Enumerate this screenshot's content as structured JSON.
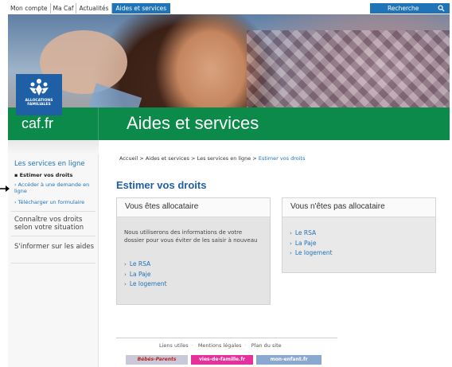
{
  "topnav": {
    "items": [
      "Mon compte",
      "Ma Caf",
      "Actualités",
      "Aides et services"
    ],
    "active_index": 3,
    "search_label": "Recherche"
  },
  "header": {
    "logo_text_line1": "ALLOCATIONS",
    "logo_text_line2": "FAMILIALES",
    "site_name": "caf.fr",
    "section_title": "Aides et services"
  },
  "sidebar": {
    "section_title": "Les services en ligne",
    "subitems": [
      {
        "label": "Estimer vos droits",
        "active": true
      },
      {
        "label": "Accéder à une demande en ligne",
        "active": false
      },
      {
        "label": "Télécharger un formulaire",
        "active": false
      }
    ],
    "other_items": [
      "Connaître vos droits selon votre situation",
      "S'informer sur les aides"
    ]
  },
  "breadcrumb": {
    "items": [
      "Accueil",
      "Aides et services",
      "Les services en ligne"
    ],
    "current": "Estimer vos droits",
    "separator": ">"
  },
  "main": {
    "title": "Estimer vos droits",
    "box_allocataire": {
      "heading": "Vous êtes allocataire",
      "text": "Nous utiliserons des informations de votre dossier pour vous éviter de les saisir à nouveau",
      "links": [
        "Le RSA",
        "La Paje",
        "Le logement"
      ]
    },
    "box_non_allocataire": {
      "heading": "Vous n'êtes pas allocataire",
      "links": [
        "Le RSA",
        "La Paje",
        "Le logement"
      ]
    }
  },
  "footer": {
    "links": [
      "Liens utiles",
      "Mentions légales",
      "Plan du site"
    ],
    "partners": [
      "Bébés-Parents",
      "vies-de-famille.fr",
      "mon-enfant.fr"
    ]
  },
  "colors": {
    "brand_blue": "#1f73b7",
    "brand_green": "#0b8a4a",
    "title_blue": "#1f5fa6"
  }
}
